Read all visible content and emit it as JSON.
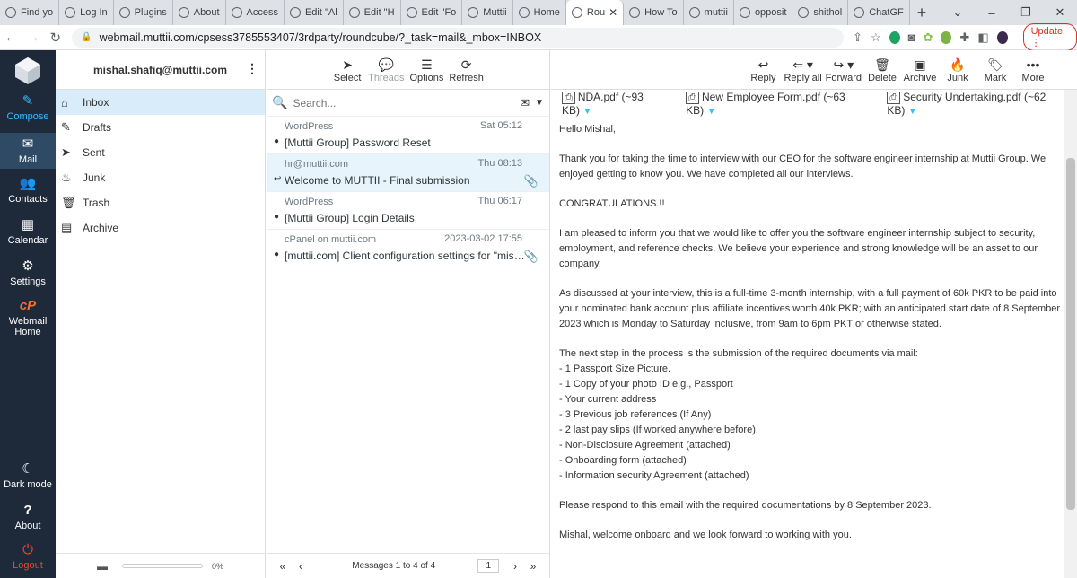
{
  "browser": {
    "tabs": [
      {
        "label": "Find yo",
        "icon": "slack-icon"
      },
      {
        "label": "Log In",
        "icon": "wordpress-icon"
      },
      {
        "label": "Plugins",
        "icon": "wordpress-icon"
      },
      {
        "label": "About",
        "icon": "wordpress-icon"
      },
      {
        "label": "Access",
        "icon": "wordpress-icon"
      },
      {
        "label": "Edit \"Al",
        "icon": "wordpress-icon"
      },
      {
        "label": "Edit \"H",
        "icon": "wordpress-icon"
      },
      {
        "label": "Edit \"Fo",
        "icon": "wordpress-icon"
      },
      {
        "label": "Muttii",
        "icon": "figma-icon"
      },
      {
        "label": "Home",
        "icon": "wordpress-icon"
      },
      {
        "label": "Rou",
        "icon": "roundcube-icon",
        "active": true
      },
      {
        "label": "How To",
        "icon": "youtube-icon"
      },
      {
        "label": "muttii",
        "icon": "google-icon"
      },
      {
        "label": "opposit",
        "icon": "google-icon"
      },
      {
        "label": "shithol",
        "icon": "google-icon"
      },
      {
        "label": "ChatGF",
        "icon": "chatgpt-icon"
      }
    ],
    "url": "webmail.muttii.com/cpsess3785553407/3rdparty/roundcube/?_task=mail&_mbox=INBOX",
    "update_label": "Update"
  },
  "nav": {
    "compose": "Compose",
    "mail": "Mail",
    "contacts": "Contacts",
    "calendar": "Calendar",
    "settings": "Settings",
    "webmail_home": "Webmail Home",
    "dark_mode": "Dark mode",
    "about": "About",
    "logout": "Logout"
  },
  "account": {
    "email": "mishal.shafiq@muttii.com"
  },
  "folders": [
    {
      "label": "Inbox",
      "icon": "inbox-icon",
      "active": true
    },
    {
      "label": "Drafts",
      "icon": "pencil-icon"
    },
    {
      "label": "Sent",
      "icon": "paper-plane-icon"
    },
    {
      "label": "Junk",
      "icon": "fire-icon"
    },
    {
      "label": "Trash",
      "icon": "trash-icon"
    },
    {
      "label": "Archive",
      "icon": "archive-icon"
    }
  ],
  "quota": {
    "percent_label": "0%",
    "value": 0
  },
  "list_toolbar": {
    "select": "Select",
    "threads": "Threads",
    "options": "Options",
    "refresh": "Refresh"
  },
  "search": {
    "placeholder": "Search..."
  },
  "messages": [
    {
      "from": "WordPress",
      "date": "Sat 05:12",
      "subject": "[Muttii Group] Password Reset",
      "flag": "unread",
      "attachment": false
    },
    {
      "from": "hr@muttii.com",
      "date": "Thu 08:13",
      "subject": "Welcome to MUTTII - Final submission",
      "flag": "replied",
      "attachment": true,
      "selected": true
    },
    {
      "from": "WordPress",
      "date": "Thu 06:17",
      "subject": "[Muttii Group] Login Details",
      "flag": "unread",
      "attachment": false
    },
    {
      "from": "cPanel on muttii.com",
      "date": "2023-03-02 17:55",
      "subject": "[muttii.com] Client configuration settings for \"mishal....",
      "flag": "unread",
      "attachment": true
    }
  ],
  "pager": {
    "count": "Messages 1 to 4 of 4",
    "page": "1"
  },
  "view_toolbar": {
    "reply": "Reply",
    "reply_all": "Reply all",
    "forward": "Forward",
    "delete": "Delete",
    "archive": "Archive",
    "junk": "Junk",
    "mark": "Mark",
    "more": "More"
  },
  "attachments": [
    {
      "label": "NDA.pdf (~93 KB)"
    },
    {
      "label": "New Employee Form.pdf (~63 KB)"
    },
    {
      "label": "Security Undertaking.pdf (~62 KB)"
    }
  ],
  "email_body": {
    "greeting": "Hello Mishal,",
    "p1": "Thank you for taking the time to interview with our CEO for the software engineer internship at Muttii Group. We enjoyed getting to know you. We have completed all our interviews.",
    "p2": "CONGRATULATIONS.!!",
    "p3": "I am pleased to inform you that we would like to offer you the software engineer internship subject to security, employment, and reference checks. We believe your experience and strong knowledge will be an asset to our company.",
    "p4": "As discussed at your interview, this is a full-time 3-month internship, with a full payment of 60k PKR to be paid into your nominated bank account plus affiliate incentives worth 40k PKR; with an anticipated start date of 8 September 2023 which is Monday to Saturday inclusive, from 9am to 6pm PKT or otherwise stated.",
    "p5": "The next step in the process is the submission of the required documents via mail:",
    "items": [
      "- 1 Passport Size Picture.",
      "- 1 Copy of your photo ID e.g., Passport",
      "- Your current address",
      "- 3 Previous job references (If Any)",
      "- 2 last pay slips (If worked anywhere before).",
      "- Non-Disclosure Agreement (attached)",
      "- Onboarding form (attached)",
      "- Information security Agreement (attached)"
    ],
    "p6": "Please respond to this email with the required documentations by 8 September 2023.",
    "p7": "Mishal, welcome onboard and we look forward to working with you."
  }
}
